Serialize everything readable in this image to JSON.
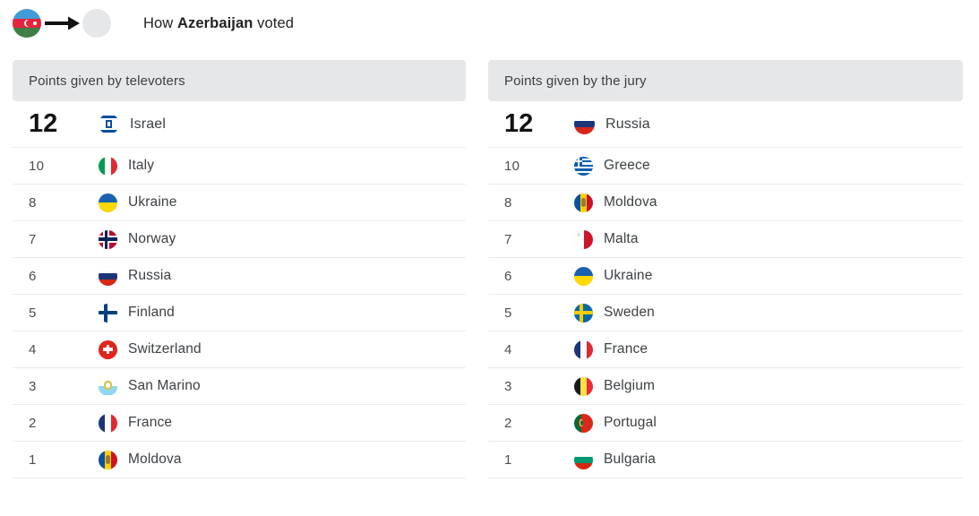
{
  "header": {
    "source_country": "Azerbaijan",
    "source_flag": "azerbaijan-flag-icon",
    "arrow": "arrow-right-icon",
    "title_prefix": "How ",
    "title_country": "Azerbaijan",
    "title_suffix": " voted"
  },
  "colors": {
    "panel_header_bg": "#e5e7e9",
    "row_divider": "#ececee",
    "text_primary": "#3c4043",
    "text_strong": "#121212",
    "page_bg": "#ffffff"
  },
  "panels": [
    {
      "id": "televote",
      "title": "Points given by televoters",
      "rows": [
        {
          "points": "12",
          "country": "Israel",
          "flag": "israel-flag-icon"
        },
        {
          "points": "10",
          "country": "Italy",
          "flag": "italy-flag-icon"
        },
        {
          "points": "8",
          "country": "Ukraine",
          "flag": "ukraine-flag-icon"
        },
        {
          "points": "7",
          "country": "Norway",
          "flag": "norway-flag-icon"
        },
        {
          "points": "6",
          "country": "Russia",
          "flag": "russia-flag-icon"
        },
        {
          "points": "5",
          "country": "Finland",
          "flag": "finland-flag-icon"
        },
        {
          "points": "4",
          "country": "Switzerland",
          "flag": "switzerland-flag-icon"
        },
        {
          "points": "3",
          "country": "San Marino",
          "flag": "san-marino-flag-icon"
        },
        {
          "points": "2",
          "country": "France",
          "flag": "france-flag-icon"
        },
        {
          "points": "1",
          "country": "Moldova",
          "flag": "moldova-flag-icon"
        }
      ]
    },
    {
      "id": "jury",
      "title": "Points given by the jury",
      "rows": [
        {
          "points": "12",
          "country": "Russia",
          "flag": "russia-flag-icon"
        },
        {
          "points": "10",
          "country": "Greece",
          "flag": "greece-flag-icon"
        },
        {
          "points": "8",
          "country": "Moldova",
          "flag": "moldova-flag-icon"
        },
        {
          "points": "7",
          "country": "Malta",
          "flag": "malta-flag-icon"
        },
        {
          "points": "6",
          "country": "Ukraine",
          "flag": "ukraine-flag-icon"
        },
        {
          "points": "5",
          "country": "Sweden",
          "flag": "sweden-flag-icon"
        },
        {
          "points": "4",
          "country": "France",
          "flag": "france-flag-icon"
        },
        {
          "points": "3",
          "country": "Belgium",
          "flag": "belgium-flag-icon"
        },
        {
          "points": "2",
          "country": "Portugal",
          "flag": "portugal-flag-icon"
        },
        {
          "points": "1",
          "country": "Bulgaria",
          "flag": "bulgaria-flag-icon"
        }
      ]
    }
  ]
}
